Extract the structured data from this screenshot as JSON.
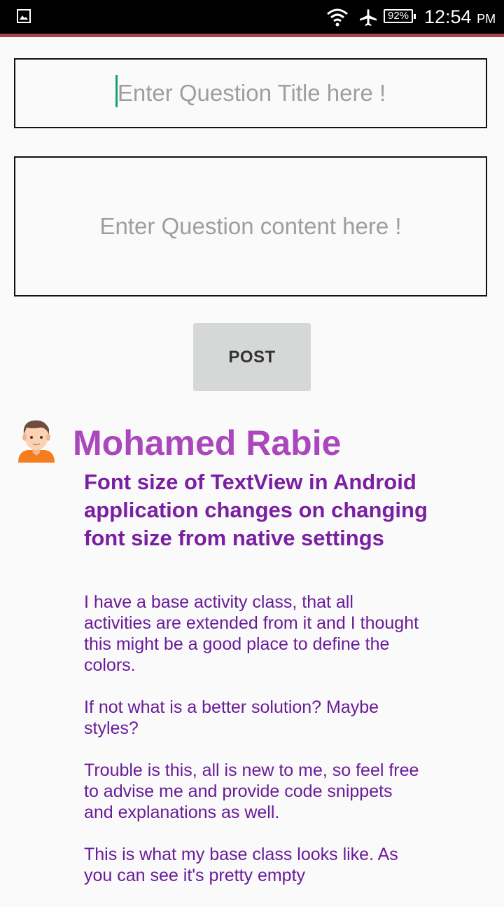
{
  "status_bar": {
    "notification_icon": "gallery-icon",
    "wifi_icon": "wifi-icon",
    "airplane_icon": "airplane-mode-icon",
    "battery": "92%",
    "time": "12:54",
    "ampm": "PM"
  },
  "form": {
    "title_placeholder": "Enter Question Title here !",
    "content_placeholder": "Enter Question content here !",
    "post_label": "POST"
  },
  "question": {
    "author": "Mohamed Rabie",
    "avatar_icon": "user-avatar-icon",
    "title": "Font size of TextView in Android application changes on changing font size from native settings",
    "body": [
      "I have a base activity class, that all activities are extended from it and I thought this might be a good place to define the colors.",
      "If not what is a better solution? Maybe styles?",
      "Trouble is this, all is new to me, so feel free to advise me and provide code snippets and explanations as well.",
      "This is what my base class looks like. As you can see it's pretty empty"
    ]
  },
  "colors": {
    "accent_bar": "#a94442",
    "author_name": "#ab47bc",
    "title": "#7b1fa2",
    "body": "#6a1b9a",
    "caret": "#1aa06c",
    "button_bg": "#d6d7d7"
  }
}
